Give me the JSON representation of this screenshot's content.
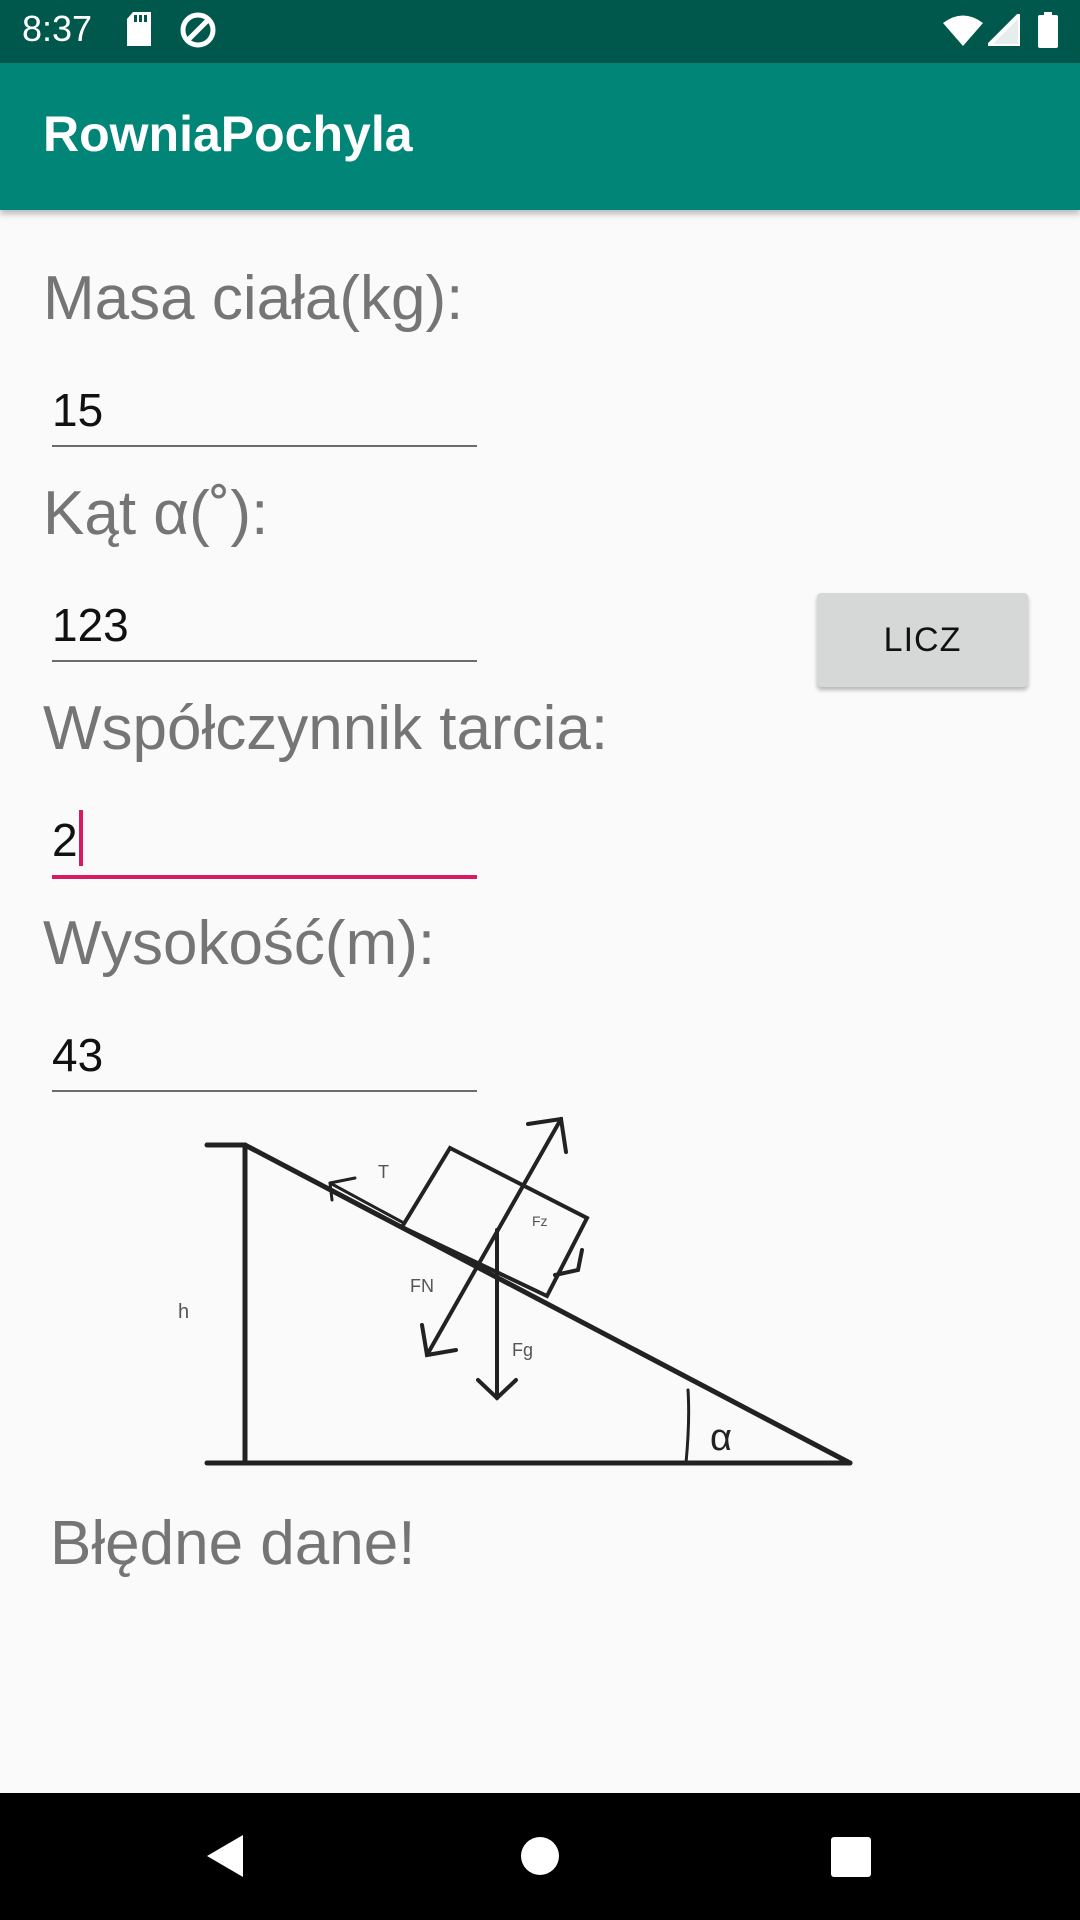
{
  "status": {
    "time": "8:37",
    "icons": [
      "sd-card-icon",
      "sync-icon",
      "wifi-icon",
      "signal-icon",
      "battery-icon"
    ]
  },
  "app": {
    "title": "RowniaPochyla",
    "primary_color": "#008577",
    "primary_dark_color": "#00574b",
    "accent_color": "#d81b60"
  },
  "form": {
    "mass_label": "Masa ciała(kg):",
    "mass_value": "15",
    "angle_label": "Kąt α(˚):",
    "angle_value": "123",
    "friction_label": "Współczynnik tarcia:",
    "friction_value": "2",
    "height_label": "Wysokość(m):",
    "height_value": "43"
  },
  "button": {
    "calc_label": "LICZ"
  },
  "diagram": {
    "labels": {
      "h": "h",
      "t": "T",
      "fz": "Fz",
      "fn": "FN",
      "fg": "Fg",
      "alpha": "α"
    }
  },
  "result": {
    "message": "Błędne dane!"
  },
  "nav": {
    "icons": [
      "back-icon",
      "home-icon",
      "recents-icon"
    ]
  }
}
